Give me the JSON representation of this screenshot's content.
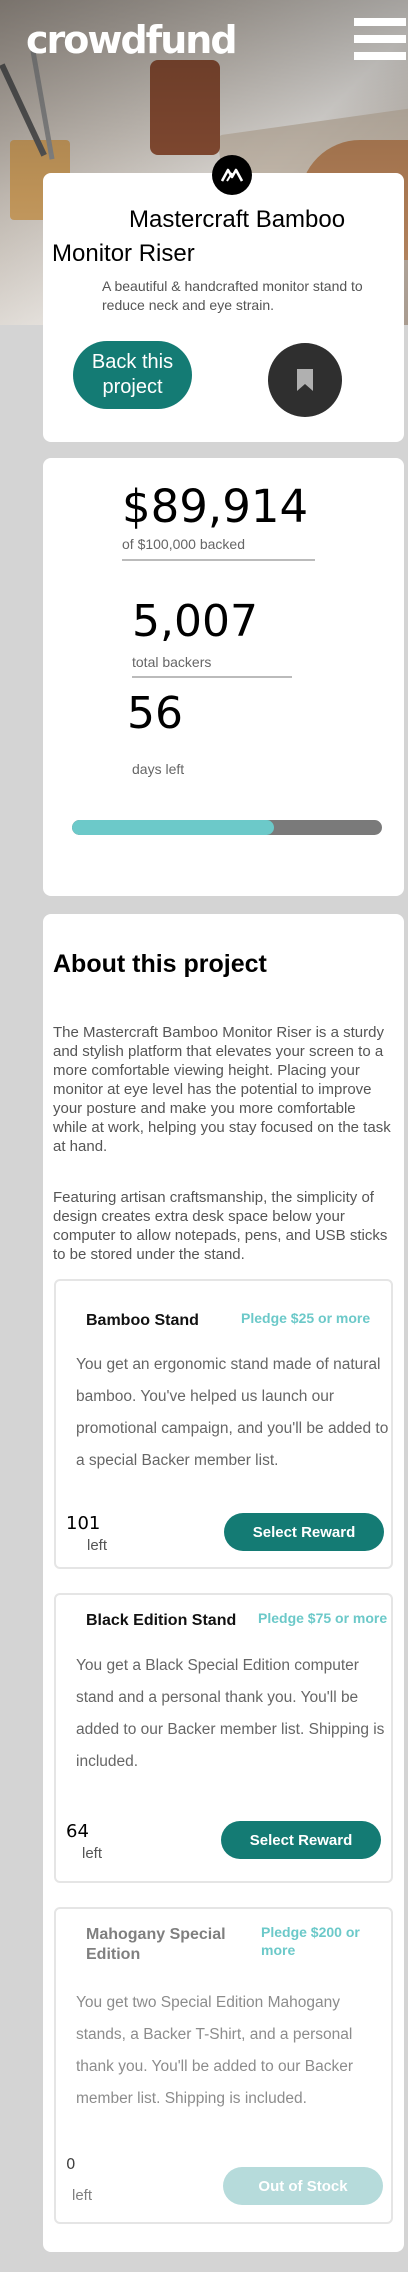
{
  "header": {
    "logo": "crowdfund",
    "menu_icon": "hamburger-icon"
  },
  "project": {
    "logo_text": "M",
    "title": "Mastercraft Bamboo Monitor Riser",
    "subtitle": "A beautiful & handcrafted monitor stand to reduce neck and eye strain.",
    "back_label": "Back this project",
    "bookmark_icon": "bookmark-icon"
  },
  "stats": {
    "amount": "$89,914",
    "amount_caption": "of $100,000 backed",
    "backers": "5,007",
    "backers_caption": "total backers",
    "days": "56",
    "days_caption": "days left",
    "progress_fraction": 0.65
  },
  "about": {
    "title": "About this project",
    "paragraphs": [
      "The Mastercraft Bamboo Monitor Riser is a sturdy and stylish platform that elevates your screen to a more comfortable viewing height. Placing your monitor at eye level has the potential to improve your posture and make you more comfortable while at work, helping you stay focused on the task at hand.",
      "Featuring artisan craftsmanship, the simplicity of design creates extra desk space below your computer to allow notepads, pens, and USB sticks to be stored under the stand."
    ],
    "rewards": [
      {
        "name": "Bamboo Stand",
        "pledge": "Pledge $25 or more",
        "description": "You get an ergonomic stand made of natural bamboo. You've helped us launch our promotional campaign, and you'll be added to a special Backer member list.",
        "count": "101",
        "left_label": "left",
        "button": "Select Reward"
      },
      {
        "name": "Black Edition Stand",
        "pledge": "Pledge $75 or more",
        "description": "You get a Black Special Edition computer stand and a personal thank you. You'll be added to our Backer member list. Shipping is included.",
        "count": "64",
        "left_label": "left",
        "button": "Select Reward"
      },
      {
        "name": "Mahogany Special Edition",
        "pledge": "Pledge $200 or more",
        "description": "You get two Special Edition Mahogany stands, a Backer T-Shirt, and a personal thank you. You'll be added to our Backer member list. Shipping is included.",
        "count": "0",
        "left_label": "left",
        "button": "Out of Stock"
      }
    ]
  },
  "colors": {
    "primary": "#147b74",
    "accent": "#6cc9c9",
    "dark": "#2f2f2f",
    "disabled": "#b6dbdb"
  }
}
